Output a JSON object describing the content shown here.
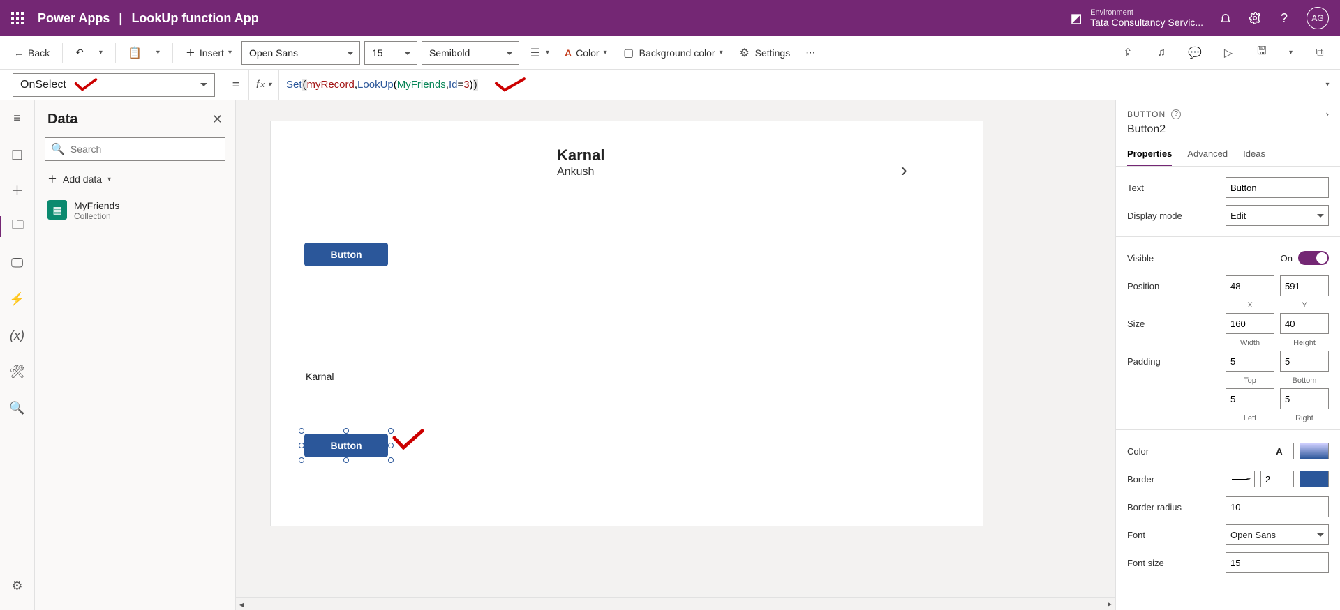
{
  "header": {
    "app": "Power Apps",
    "separator": "|",
    "title": "LookUp function App",
    "env_label": "Environment",
    "env_name": "Tata Consultancy Servic...",
    "avatar": "AG"
  },
  "toolbar": {
    "back": "Back",
    "insert": "Insert",
    "font_family": "Open Sans",
    "font_size": "15",
    "font_weight": "Semibold",
    "color": "Color",
    "bgcolor": "Background color",
    "settings": "Settings"
  },
  "formula": {
    "property": "OnSelect",
    "fx": "fx",
    "set": "Set",
    "var": "myRecord",
    "lookup": "LookUp",
    "table": "MyFriends",
    "field": "Id",
    "val": "3"
  },
  "data_panel": {
    "title": "Data",
    "search_placeholder": "Search",
    "add_data": "Add data",
    "items": [
      {
        "name": "MyFriends",
        "type": "Collection"
      }
    ]
  },
  "canvas": {
    "card_title": "Karnal",
    "card_sub": "Ankush",
    "button1": "Button",
    "label1": "Karnal",
    "button2": "Button"
  },
  "props": {
    "type": "BUTTON",
    "name": "Button2",
    "tabs": [
      "Properties",
      "Advanced",
      "Ideas"
    ],
    "text_label": "Text",
    "text_value": "Button",
    "display_mode_label": "Display mode",
    "display_mode_value": "Edit",
    "visible_label": "Visible",
    "visible_value": "On",
    "position_label": "Position",
    "pos_x": "48",
    "pos_y": "591",
    "x_label": "X",
    "y_label": "Y",
    "size_label": "Size",
    "width": "160",
    "height": "40",
    "w_label": "Width",
    "h_label": "Height",
    "padding_label": "Padding",
    "pad_top": "5",
    "pad_bottom": "5",
    "pad_left": "5",
    "pad_right": "5",
    "top_label": "Top",
    "bottom_label": "Bottom",
    "left_label": "Left",
    "right_label": "Right",
    "color_label": "Color",
    "border_label": "Border",
    "border_value": "2",
    "border_radius_label": "Border radius",
    "border_radius_value": "10",
    "font_label": "Font",
    "font_value": "Open Sans",
    "font_size_label": "Font size",
    "font_size_value": "15",
    "color_sample": "A"
  }
}
